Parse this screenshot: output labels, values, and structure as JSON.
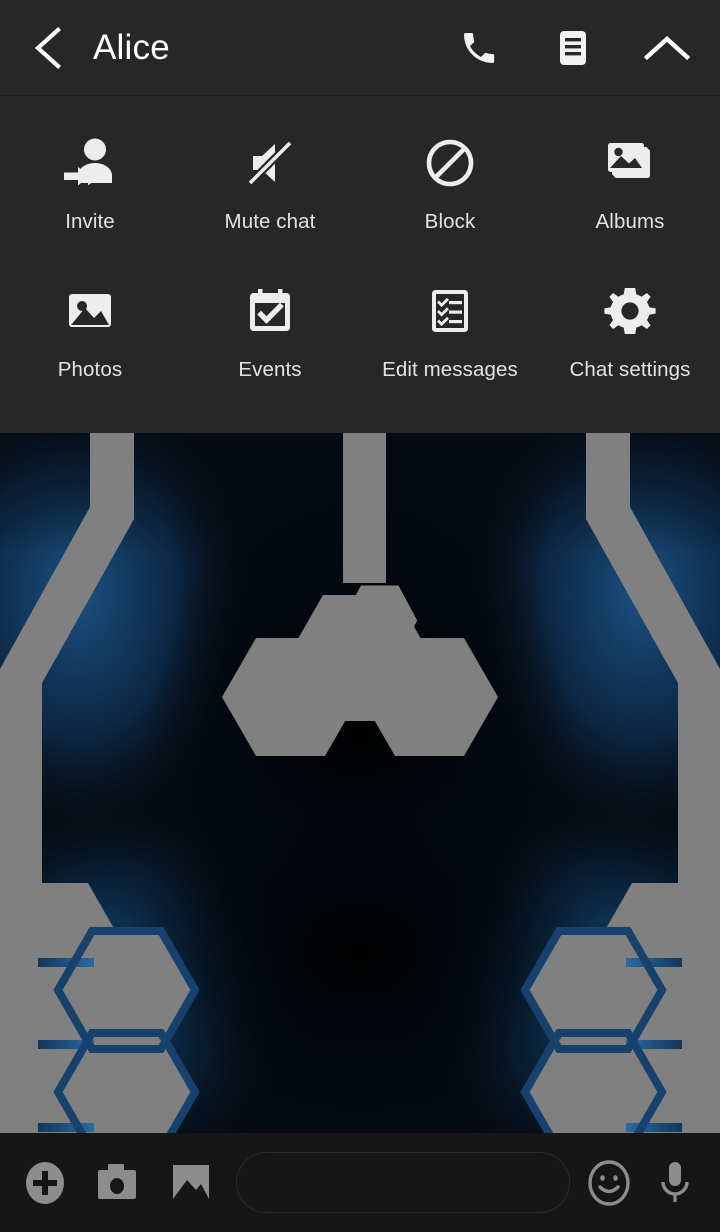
{
  "header": {
    "title": "Alice",
    "back_icon": "chevron-left-icon",
    "actions": [
      {
        "name": "call-button",
        "icon": "phone-icon"
      },
      {
        "name": "notes-button",
        "icon": "list-document-icon"
      },
      {
        "name": "collapse-panel-button",
        "icon": "chevron-up-icon"
      }
    ]
  },
  "panel": {
    "rows": [
      [
        {
          "label": "Invite",
          "icon": "add-person-icon",
          "name": "action-invite"
        },
        {
          "label": "Mute chat",
          "icon": "speaker-mute-icon",
          "name": "action-mute-chat"
        },
        {
          "label": "Block",
          "icon": "block-icon",
          "name": "action-block"
        },
        {
          "label": "Albums",
          "icon": "albums-icon",
          "name": "action-albums"
        }
      ],
      [
        {
          "label": "Photos",
          "icon": "photo-icon",
          "name": "action-photos"
        },
        {
          "label": "Events",
          "icon": "calendar-check-icon",
          "name": "action-events"
        },
        {
          "label": "Edit messages",
          "icon": "checklist-icon",
          "name": "action-edit-messages"
        },
        {
          "label": "Chat settings",
          "icon": "gear-icon",
          "name": "action-chat-settings"
        }
      ]
    ]
  },
  "composer": {
    "input_value": "",
    "input_placeholder": "",
    "buttons": [
      {
        "name": "add-attachment-button",
        "icon": "plus-circle-icon"
      },
      {
        "name": "camera-button",
        "icon": "camera-icon"
      },
      {
        "name": "gallery-button",
        "icon": "image-icon"
      },
      {
        "name": "emoji-button",
        "icon": "smiley-icon"
      },
      {
        "name": "voice-message-button",
        "icon": "microphone-icon"
      }
    ]
  },
  "colors": {
    "panel_bg": "#272727",
    "header_bg": "#272727",
    "composer_bg": "#161616",
    "icon_fill": "#ededed",
    "label_text": "#e3e3e3",
    "composer_icon": "#8d8d8d",
    "wallpaper_gray": "#808080",
    "wallpaper_blue": "#1b4a78",
    "wallpaper_dark": "#050a10"
  }
}
